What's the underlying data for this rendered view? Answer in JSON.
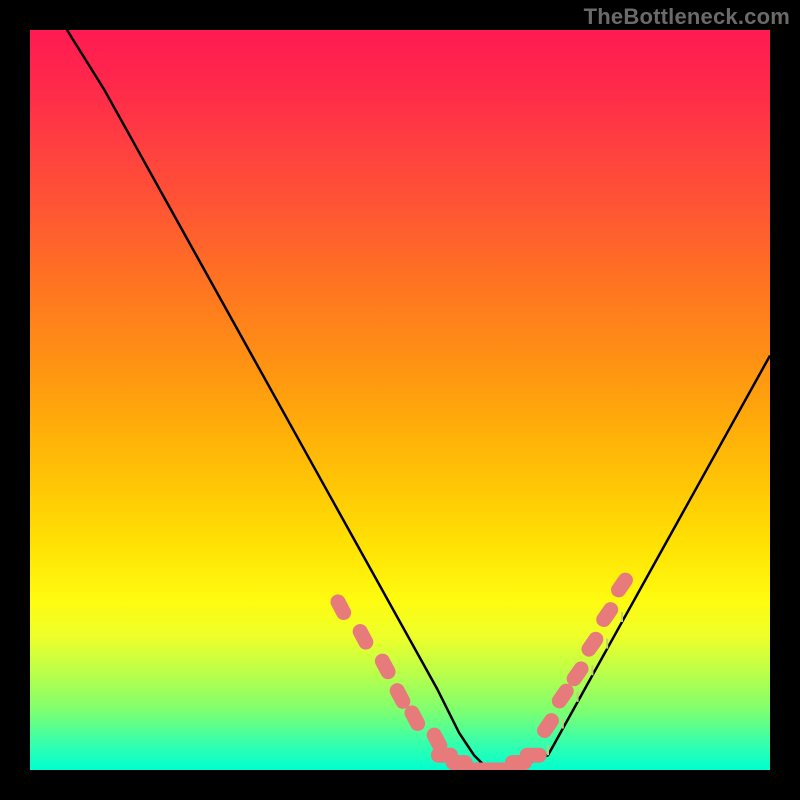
{
  "watermark": "TheBottleneck.com",
  "colors": {
    "curve_stroke": "#000000",
    "marker_fill": "#e77a7a",
    "marker_stroke": "#e77a7a",
    "tick_stroke": "#c0d070",
    "gradient_top": "#ff1a52",
    "gradient_bottom": "#00ffd0"
  },
  "chart_data": {
    "type": "line",
    "title": "",
    "xlabel": "",
    "ylabel": "",
    "xlim": [
      0,
      100
    ],
    "ylim": [
      0,
      100
    ],
    "x": [
      5,
      10,
      15,
      20,
      25,
      30,
      35,
      40,
      45,
      50,
      55,
      58,
      60,
      62,
      65,
      70,
      75,
      80,
      85,
      90,
      95,
      100
    ],
    "values": [
      100,
      92,
      83,
      74,
      65,
      56,
      47,
      38,
      29,
      20,
      11,
      5,
      2,
      0,
      0,
      2,
      11,
      20,
      29,
      38,
      47,
      56
    ],
    "markers": {
      "left_band_x": [
        42,
        45,
        48,
        50,
        52,
        55
      ],
      "left_band_y": [
        22,
        18,
        14,
        10,
        7,
        4
      ],
      "bottom_band_x": [
        56,
        58,
        60,
        62,
        64,
        66,
        68
      ],
      "bottom_band_y": [
        2,
        1,
        0,
        0,
        0,
        1,
        2
      ],
      "right_band_x": [
        70,
        72,
        74,
        76,
        78,
        80
      ],
      "right_band_y": [
        6,
        10,
        13,
        17,
        21,
        25
      ]
    }
  }
}
